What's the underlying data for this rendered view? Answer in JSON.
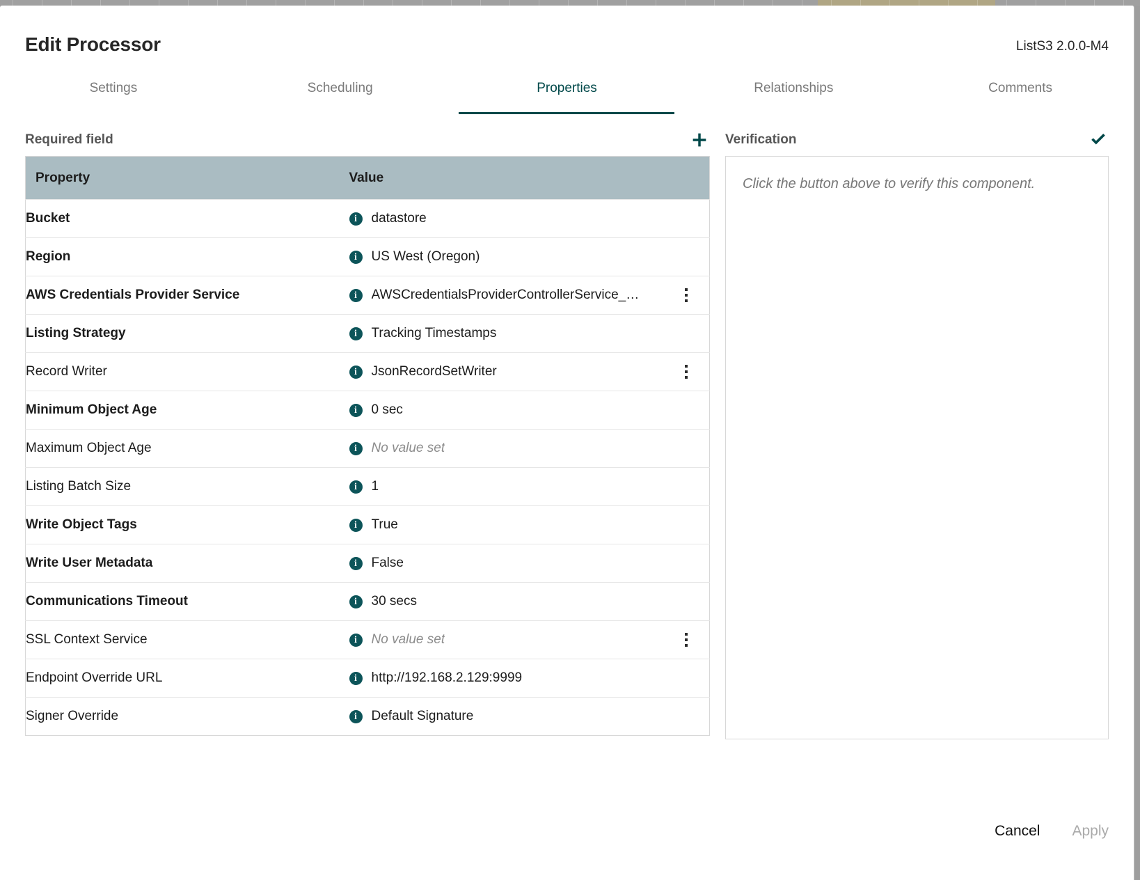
{
  "window": {
    "title": "Edit Processor",
    "processor_type": "ListS3 2.0.0-M4"
  },
  "tabs": [
    {
      "label": "Settings",
      "active": false
    },
    {
      "label": "Scheduling",
      "active": false
    },
    {
      "label": "Properties",
      "active": true
    },
    {
      "label": "Relationships",
      "active": false
    },
    {
      "label": "Comments",
      "active": false
    }
  ],
  "properties_panel": {
    "section_label": "Required field",
    "add_icon": "plus-icon",
    "columns": {
      "property": "Property",
      "value": "Value"
    },
    "info_icon": "info-icon",
    "menu_icon": "vertical-ellipsis-icon",
    "unset_text": "No value set",
    "rows": [
      {
        "name": "Bucket",
        "value": "datastore",
        "required": true,
        "unset": false,
        "menu": false
      },
      {
        "name": "Region",
        "value": "US West (Oregon)",
        "required": true,
        "unset": false,
        "menu": false
      },
      {
        "name": "AWS Credentials Provider Service",
        "value": "AWSCredentialsProviderControllerService_…",
        "required": true,
        "unset": false,
        "menu": true
      },
      {
        "name": "Listing Strategy",
        "value": "Tracking Timestamps",
        "required": true,
        "unset": false,
        "menu": false
      },
      {
        "name": "Record Writer",
        "value": "JsonRecordSetWriter",
        "required": false,
        "unset": false,
        "menu": true
      },
      {
        "name": "Minimum Object Age",
        "value": "0 sec",
        "required": true,
        "unset": false,
        "menu": false
      },
      {
        "name": "Maximum Object Age",
        "value": "No value set",
        "required": false,
        "unset": true,
        "menu": false
      },
      {
        "name": "Listing Batch Size",
        "value": "1",
        "required": false,
        "unset": false,
        "menu": false
      },
      {
        "name": "Write Object Tags",
        "value": "True",
        "required": true,
        "unset": false,
        "menu": false
      },
      {
        "name": "Write User Metadata",
        "value": "False",
        "required": true,
        "unset": false,
        "menu": false
      },
      {
        "name": "Communications Timeout",
        "value": "30 secs",
        "required": true,
        "unset": false,
        "menu": false
      },
      {
        "name": "SSL Context Service",
        "value": "No value set",
        "required": false,
        "unset": true,
        "menu": true
      },
      {
        "name": "Endpoint Override URL",
        "value": "http://192.168.2.129:9999",
        "required": false,
        "unset": false,
        "menu": false
      },
      {
        "name": "Signer Override",
        "value": "Default Signature",
        "required": false,
        "unset": false,
        "menu": false
      }
    ]
  },
  "verification_panel": {
    "section_label": "Verification",
    "verify_icon": "check-icon",
    "placeholder": "Click the button above to verify this component."
  },
  "footer": {
    "cancel_label": "Cancel",
    "apply_label": "Apply"
  },
  "colors": {
    "accent": "#004849",
    "info_icon": "#0c5459",
    "table_header": "#aabcc2",
    "muted_text": "#7a7a7a"
  }
}
